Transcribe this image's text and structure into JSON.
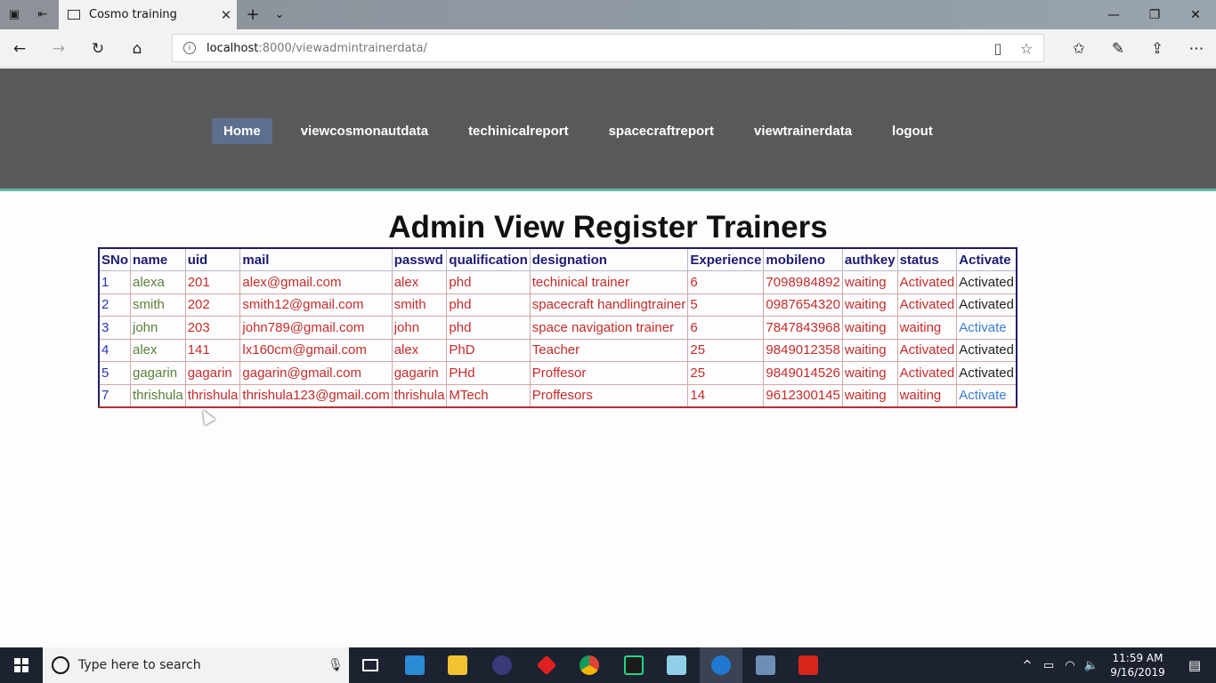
{
  "browser": {
    "tab_title": "Cosmo training",
    "url_host": "localhost",
    "url_path": ":8000/viewadmintrainerdata/"
  },
  "nav": {
    "items": [
      "Home",
      "viewcosmonautdata",
      "techinicalreport",
      "spacecraftreport",
      "viewtrainerdata",
      "logout"
    ],
    "active_index": 0
  },
  "page": {
    "title": "Admin View Register Trainers"
  },
  "table": {
    "headers": [
      "SNo",
      "name",
      "uid",
      "mail",
      "passwd",
      "qualification",
      "designation",
      "Experience",
      "mobileno",
      "authkey",
      "status",
      "Activate"
    ],
    "rows": [
      [
        "1",
        "alexa",
        "201",
        "alex@gmail.com",
        "alex",
        "phd",
        "techinical trainer",
        "6",
        "7098984892",
        "waiting",
        "Activated",
        "Activated"
      ],
      [
        "2",
        "smith",
        "202",
        "smith12@gmail.com",
        "smith",
        "phd",
        "spacecraft handlingtrainer",
        "5",
        "0987654320",
        "waiting",
        "Activated",
        "Activated"
      ],
      [
        "3",
        "john",
        "203",
        "john789@gmail.com",
        "john",
        "phd",
        "space navigation trainer",
        "6",
        "7847843968",
        "waiting",
        "waiting",
        "Activate"
      ],
      [
        "4",
        "alex",
        "141",
        "lx160cm@gmail.com",
        "alex",
        "PhD",
        "Teacher",
        "25",
        "9849012358",
        "waiting",
        "Activated",
        "Activated"
      ],
      [
        "5",
        "gagarin",
        "gagarin",
        "gagarin@gmail.com",
        "gagarin",
        "PHd",
        "Proffesor",
        "25",
        "9849014526",
        "waiting",
        "Activated",
        "Activated"
      ],
      [
        "7",
        "thrishula",
        "thrishula",
        "thrishula123@gmail.com",
        "thrishula",
        "MTech",
        "Proffesors",
        "14",
        "9612300145",
        "waiting",
        "waiting",
        "Activate"
      ]
    ]
  },
  "taskbar": {
    "search_placeholder": "Type here to search",
    "time": "11:59 AM",
    "date": "9/16/2019"
  },
  "colors": {
    "header_bg": "#595959",
    "header_accent": "#5fb9a7",
    "nav_active": "#5d6f8c",
    "activate_link": "#3b7fd1"
  }
}
